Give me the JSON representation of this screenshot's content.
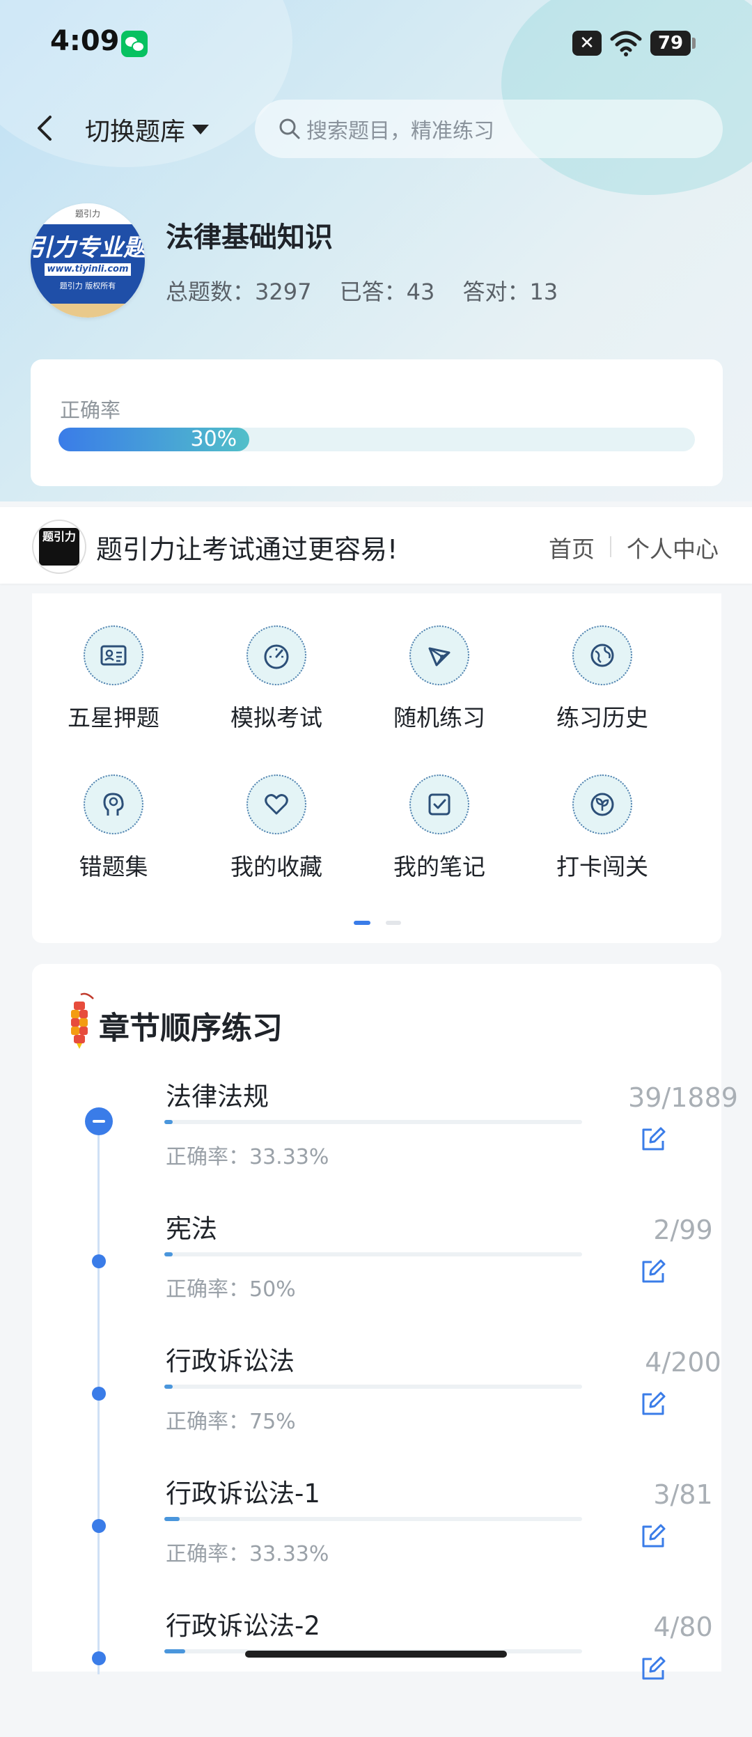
{
  "status_bar": {
    "time": "4:09",
    "battery": "79",
    "sim_label": "✕"
  },
  "header": {
    "switch_label": "切换题库",
    "search_placeholder": "搜索题目，精准练习"
  },
  "bank": {
    "logo_main": "引力专业题",
    "logo_url": "www.tiyinli.com",
    "logo_copyright": "题引力 版权所有",
    "title": "法律基础知识",
    "stats": {
      "total": "总题数：3297",
      "answered": "已答：43",
      "correct": "答对：13"
    }
  },
  "accuracy": {
    "label": "正确率",
    "value": "30%",
    "fraction": 0.3
  },
  "promo": {
    "logo_text": "题引力",
    "text": "题引力让考试通过更容易!",
    "home": "首页",
    "personal": "个人中心"
  },
  "features": [
    {
      "label": "五星押题",
      "icon": "id-card-icon"
    },
    {
      "label": "模拟考试",
      "icon": "gauge-icon"
    },
    {
      "label": "随机练习",
      "icon": "shuffle-icon"
    },
    {
      "label": "练习历史",
      "icon": "globe-icon"
    },
    {
      "label": "错题集",
      "icon": "head-icon"
    },
    {
      "label": "我的收藏",
      "icon": "heart-icon"
    },
    {
      "label": "我的笔记",
      "icon": "note-icon"
    },
    {
      "label": "打卡闯关",
      "icon": "leaf-badge-icon"
    }
  ],
  "chapters": {
    "title": "章节顺序练习",
    "items": [
      {
        "name": "法律法规",
        "accuracy": "正确率：33.33%",
        "count": "39/1889",
        "progress": 0.0206,
        "expanded": true
      },
      {
        "name": "宪法",
        "accuracy": "正确率：50%",
        "count": "2/99",
        "progress": 0.0202,
        "expanded": false
      },
      {
        "name": "行政诉讼法",
        "accuracy": "正确率：75%",
        "count": "4/200",
        "progress": 0.02,
        "expanded": false
      },
      {
        "name": "行政诉讼法-1",
        "accuracy": "正确率：33.33%",
        "count": "3/81",
        "progress": 0.037,
        "expanded": false
      },
      {
        "name": "行政诉讼法-2",
        "accuracy": "",
        "count": "4/80",
        "progress": 0.05,
        "expanded": false
      }
    ]
  },
  "colors": {
    "accent": "#3a7ce8",
    "teal": "#52bfc9",
    "icon_bg": "#e4f4f6",
    "icon_stroke": "#2c4f78"
  }
}
